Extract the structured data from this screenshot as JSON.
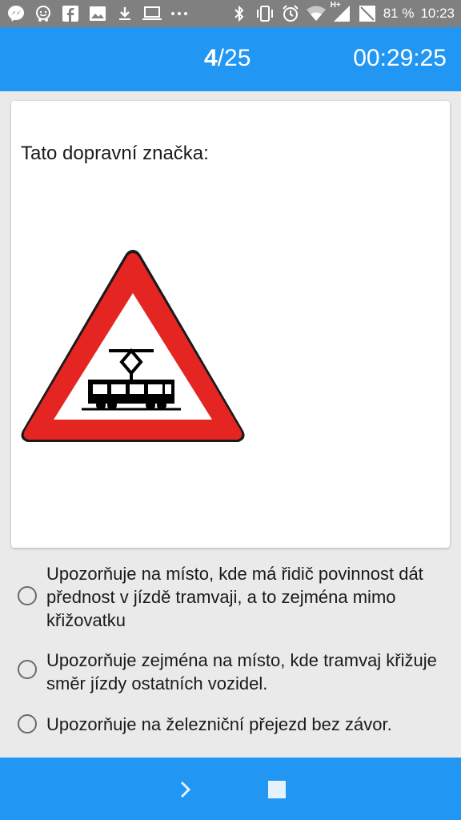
{
  "status_bar": {
    "battery_text": "81 %",
    "time": "10:23",
    "network_label": "H+",
    "icons_left": [
      "messenger-icon",
      "waze-icon",
      "facebook-icon",
      "gallery-icon",
      "download-icon",
      "laptop-icon",
      "more-dots-icon"
    ],
    "icons_right": [
      "bluetooth-icon",
      "vibrate-icon",
      "alarm-icon",
      "wifi-icon",
      "signal-icon",
      "battery-icon"
    ]
  },
  "header": {
    "current": "4",
    "total": "/25",
    "timer": "00:29:25"
  },
  "question": {
    "text": "Tato dopravní značka:",
    "image_icon": "tram-warning-sign-icon"
  },
  "answers": [
    {
      "label": "Upozorňuje na místo, kde má řidič povinnost dát přednost v jízdě tramvaji, a to zejména mimo křižovatku",
      "selected": false
    },
    {
      "label": "Upozorňuje zejména na místo, kde tramvaj křižuje směr jízdy ostatních vozidel.",
      "selected": false
    },
    {
      "label": "Upozorňuje na železniční přejezd bez závor.",
      "selected": false
    }
  ],
  "footer": {
    "next_icon": "chevron-right-icon",
    "stop_icon": "stop-icon"
  },
  "colors": {
    "primary": "#2196f3",
    "status_bar": "#808080",
    "sign_red": "#e52521"
  }
}
